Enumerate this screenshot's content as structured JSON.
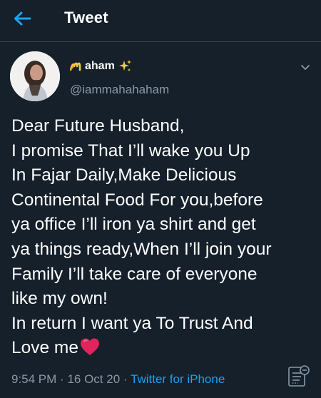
{
  "header": {
    "title": "Tweet",
    "back_icon": "arrow-left-icon"
  },
  "colors": {
    "background": "#15202b",
    "accent": "#1da1f2",
    "muted": "#8899a6",
    "divider": "#38444d",
    "heart": "#e0245e"
  },
  "author": {
    "display_name": "aham",
    "name_prefix_icon": "calligraphy-m-icon",
    "name_suffix_icon": "sparkles-icon",
    "handle": "@iammahahaham"
  },
  "tweet": {
    "lines": [
      "Dear Future Husband,",
      "I promise That I’ll wake you Up",
      "In Fajar Daily,Make Delicious",
      "Continental Food For you,before",
      "ya office I’ll iron ya shirt and get",
      "ya things ready,When I’ll join your",
      "Family I’ll take care of everyone",
      "like my own!",
      "In return I want ya To Trust And",
      "Love me"
    ],
    "trailing_emoji": "red-heart-icon"
  },
  "meta": {
    "time": "9:54 PM",
    "separator": "·",
    "date": "16 Oct 20",
    "source": "Twitter for iPhone"
  }
}
